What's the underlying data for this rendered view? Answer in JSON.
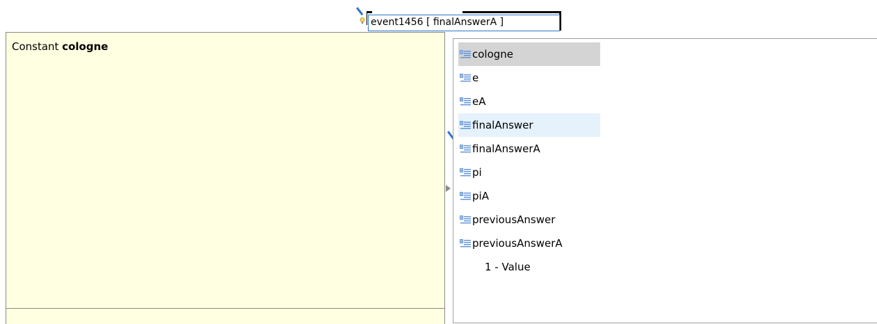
{
  "editor": {
    "label_text": "event1456 [ finalAnswerA ]"
  },
  "info_popup": {
    "kind": "Constant",
    "name": "cologne"
  },
  "proposals": {
    "items": [
      {
        "label": "cologne",
        "icon": "constant-icon",
        "state": "selected"
      },
      {
        "label": "e",
        "icon": "constant-icon",
        "state": "normal"
      },
      {
        "label": "eA",
        "icon": "constant-icon",
        "state": "normal"
      },
      {
        "label": "finalAnswer",
        "icon": "constant-icon",
        "state": "hover"
      },
      {
        "label": "finalAnswerA",
        "icon": "constant-icon",
        "state": "normal"
      },
      {
        "label": "pi",
        "icon": "constant-icon",
        "state": "normal"
      },
      {
        "label": "piA",
        "icon": "constant-icon",
        "state": "normal"
      },
      {
        "label": "previousAnswer",
        "icon": "constant-icon",
        "state": "normal"
      },
      {
        "label": "previousAnswerA",
        "icon": "constant-icon",
        "state": "normal"
      },
      {
        "label": "1 - Value",
        "icon": "",
        "state": "normal"
      }
    ]
  },
  "colors": {
    "info_background": "#ffffe1",
    "selection": "#d4d4d4",
    "hover": "#e5f1fb",
    "connector": "#2e74c9"
  }
}
